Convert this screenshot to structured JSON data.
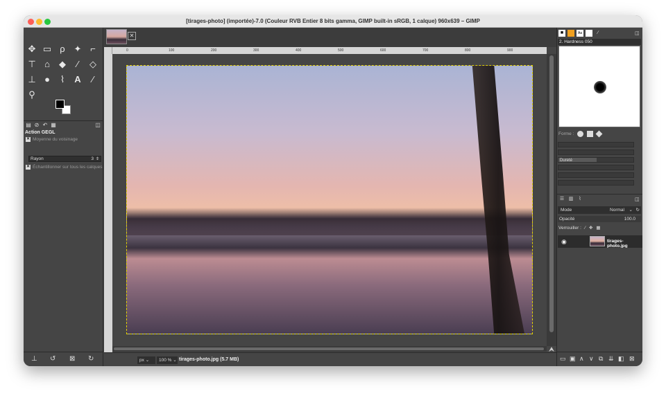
{
  "window": {
    "title": "[tirages-photo] (importée)-7.0 (Couleur RVB Entier 8 bits gamma, GIMP built-in sRGB, 1 calque) 960x639 – GIMP"
  },
  "toolbox": {
    "tools": [
      {
        "name": "move-tool-icon",
        "glyph": "✥"
      },
      {
        "name": "rect-select-icon",
        "glyph": "▭"
      },
      {
        "name": "lasso-icon",
        "glyph": "ρ"
      },
      {
        "name": "fuzzy-select-icon",
        "glyph": "✦"
      },
      {
        "name": "crop-icon",
        "glyph": "⌐"
      },
      {
        "name": "transform-icon",
        "glyph": "⊤"
      },
      {
        "name": "warp-icon",
        "glyph": "⌂"
      },
      {
        "name": "bucket-fill-icon",
        "glyph": "◆"
      },
      {
        "name": "paintbrush-icon",
        "glyph": "∕"
      },
      {
        "name": "eraser-icon",
        "glyph": "◇"
      },
      {
        "name": "clone-icon",
        "glyph": "⊥"
      },
      {
        "name": "smudge-icon",
        "glyph": "●"
      },
      {
        "name": "paths-icon",
        "glyph": "⌇"
      },
      {
        "name": "text-icon",
        "glyph": "A"
      },
      {
        "name": "color-picker-icon",
        "glyph": "∕"
      },
      {
        "name": "zoom-icon",
        "glyph": "⚲"
      }
    ],
    "tool_options": {
      "title": "Action GEGL",
      "moyenne_label": "Moyenne du voisinage",
      "rayon_label": "Rayon",
      "rayon_value": "3",
      "echantillonner_label": "Échantillonner sur tous les calques"
    }
  },
  "canvas": {
    "ruler_ticks": [
      "0",
      "100",
      "200",
      "300",
      "400",
      "500",
      "600",
      "700",
      "800",
      "900"
    ],
    "unit": "px",
    "zoom": "100 %",
    "file_label": "tirages-photo.jpg (5.7 MB)"
  },
  "brushes": {
    "brush_name": "2. Hardness 050",
    "forme_label": "Forme :",
    "durete_label": "Dureté"
  },
  "layers": {
    "mode_label": "Mode",
    "mode_value": "Normal",
    "opacity_label": "Opacité",
    "opacity_value": "100.0",
    "lock_label": "Verrouiller :",
    "layer_name": "tirages-photo.jpg"
  },
  "colors": {
    "fg": "#000000",
    "bg": "#ffffff",
    "selection_border": "#e2d400"
  }
}
